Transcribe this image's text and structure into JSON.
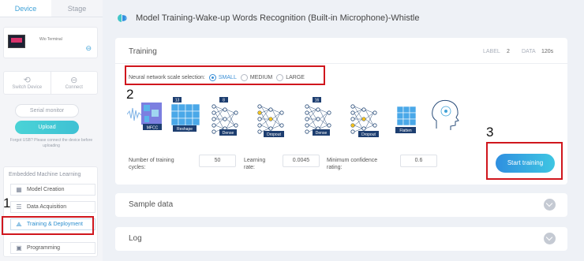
{
  "sidebar": {
    "tabs": [
      "Device",
      "Stage"
    ],
    "device_name": "Wio Terminal",
    "switch_device": "Switch Device",
    "connect": "Connect",
    "serial_monitor": "Serial monitor",
    "upload": "Upload",
    "forgot_note": "Forgot USB? Please connect the device before uploading",
    "section_title": "Embedded Machine Learning",
    "menu": [
      {
        "label": "Model Creation",
        "icon": "model-grid-icon"
      },
      {
        "label": "Data Acquisition",
        "icon": "data-bars-icon"
      },
      {
        "label": "Training & Deployment",
        "icon": "network-icon",
        "active": true
      },
      {
        "label": "Programming",
        "icon": "window-icon"
      }
    ]
  },
  "header": {
    "title": "Model Training-Wake-up Words Recognition (Built-in Microphone)-Whistle"
  },
  "training": {
    "title": "Training",
    "label_key": "LABEL",
    "label_value": "2",
    "data_key": "DATA",
    "data_value": "120s",
    "nn_label": "Neural network scale selection:",
    "sizes": [
      "SMALL",
      "MEDIUM",
      "LARGE"
    ],
    "selected_size": "SMALL",
    "pipeline": {
      "mfcc": "MFCC",
      "reshape": "Reshape",
      "reshape_badge": "13",
      "dense1": "Dense",
      "dense1_badge": "8",
      "dropout1": "Dropout",
      "dense2": "Dense",
      "dense2_badge": "16",
      "dropout2": "Dropout",
      "flatten": "Flatten"
    },
    "params": {
      "cycles_label": "Number of training cycles:",
      "cycles_value": "50",
      "rate_label": "Learning rate:",
      "rate_value": "0.0045",
      "confidence_label": "Minimum confidence rating:",
      "confidence_value": "0.6"
    },
    "start_button": "Start training"
  },
  "sample_data": {
    "title": "Sample data"
  },
  "log": {
    "title": "Log"
  },
  "annotations": [
    "1",
    "2",
    "3"
  ],
  "colors": {
    "accent": "#3b8fd6",
    "highlight": "#d0161d"
  }
}
